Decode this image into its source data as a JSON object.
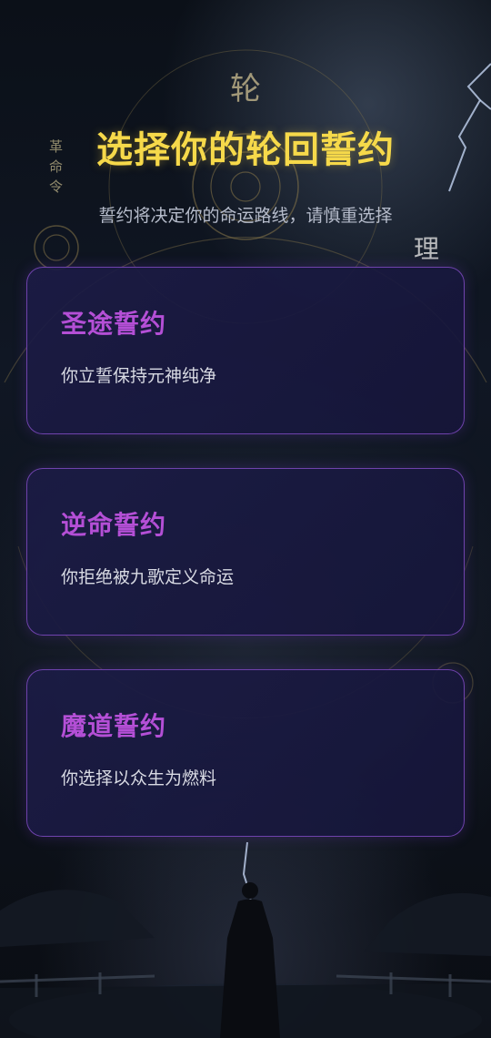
{
  "header": {
    "top_glyph": "轮",
    "title": "选择你的轮回誓约",
    "subtitle": "誓约将决定你的命运路线，请慎重选择"
  },
  "background": {
    "left_chars": [
      "革",
      "命",
      "令"
    ],
    "right_char": "理"
  },
  "oaths": [
    {
      "title": "圣途誓约",
      "desc": "你立誓保持元神纯净"
    },
    {
      "title": "逆命誓约",
      "desc": "你拒绝被九歌定义命运"
    },
    {
      "title": "魔道誓约",
      "desc": "你选择以众生为燃料"
    }
  ],
  "colors": {
    "title": "#f6d94a",
    "card_title": "#b44fd6",
    "card_border": "#844ec8",
    "card_bg": "#1c1c46"
  }
}
